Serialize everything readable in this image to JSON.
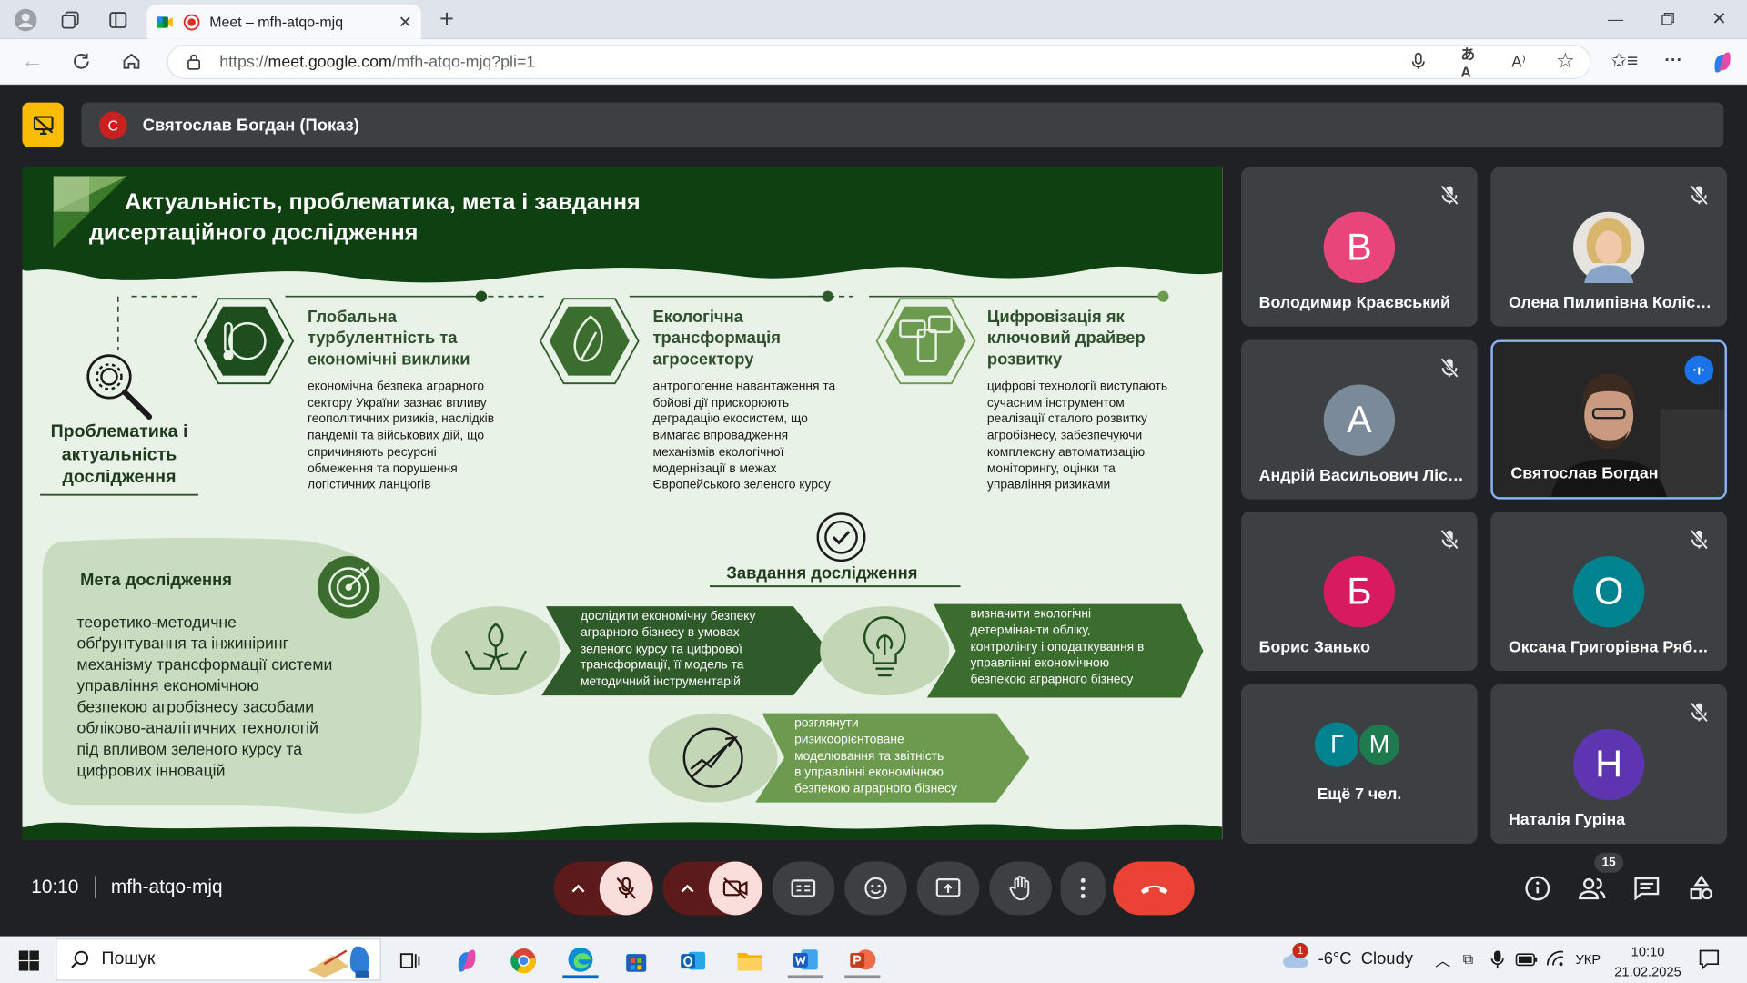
{
  "browser": {
    "tab_title": "Meet – mfh-atqo-mjq",
    "url_prefix": "https://",
    "url_host": "meet.google.com",
    "url_path": "/mfh-atqo-mjq?pli=1"
  },
  "presentation": {
    "presenter_initial": "С",
    "presenter_label": "Святослав Богдан (Показ)"
  },
  "slide": {
    "title_line1": "Актуальність, проблематика, мета і завдання",
    "title_line2": "дисертаційного дослідження",
    "problem_label_1": "Проблематика і",
    "problem_label_2": "актуальність",
    "problem_label_3": "дослідження",
    "topics": [
      {
        "title": [
          "Глобальна",
          "турбулентність та",
          "економічні виклики"
        ],
        "text": [
          "економічна безпека аграрного",
          "сектору України зазнає впливу",
          "геополітичних ризиків, наслідків",
          "пандемії та військових дій, що",
          "спричиняють ресурсні",
          "обмеження та порушення",
          "логістичних ланцюгів"
        ]
      },
      {
        "title": [
          "Екологічна",
          "трансформація",
          "агросектору"
        ],
        "text": [
          "антропогенне навантаження та",
          "бойові дії прискорюють",
          "деградацію екосистем, що",
          "вимагає впровадження",
          "механізмів екологічної",
          "модернізації в межах",
          "Європейського зеленого курсу"
        ]
      },
      {
        "title": [
          "Цифровізація як",
          "ключовий драйвер",
          "розвитку"
        ],
        "text": [
          "цифрові технології виступають",
          "сучасним інструментом",
          "реалізації сталого розвитку",
          "агробізнесу, забезпечуючи",
          "комплексну автоматизацію",
          "моніторингу, оцінки та",
          "управління ризиками"
        ]
      }
    ],
    "goal_title": "Мета дослідження",
    "goal_text": [
      "теоретико-методичне",
      "обґрунтування та інжиніринг",
      "механізму трансформації системи",
      "управління економічною",
      "безпекою агробізнесу засобами",
      "обліково-аналітичних технологій",
      "під впливом зеленого курсу та",
      "цифрових інновацій"
    ],
    "tasks_title": "Завдання дослідження",
    "tasks": [
      [
        "дослідити економічну безпеку",
        "аграрного бізнесу в умовах",
        "зеленого курсу та цифрової",
        "трансформації, її модель та",
        "методичний інструментарій"
      ],
      [
        "визначити екологічні",
        "детермінанти обліку,",
        "контролінгу і оподаткування в",
        "управлінні економічною",
        "безпекою аграрного бізнесу"
      ],
      [
        "розглянути",
        "ризикоорієнтоване",
        "моделювання та звітність",
        "в управлінні економічною",
        "безпекою аграрного бізнесу"
      ]
    ]
  },
  "participants": [
    {
      "name": "Володимир Краєвський",
      "initial": "В",
      "color": "#e8457a"
    },
    {
      "name": "Олена Пилипівна Колісник",
      "initial": "",
      "color": "#c9a67a"
    },
    {
      "name": "Андрій Васильович Лісовий",
      "initial": "А",
      "color": "#7b8a99"
    },
    {
      "name": "Святослав Богдан",
      "initial": "",
      "color": "#2a2a2a"
    },
    {
      "name": "Борис Занько",
      "initial": "Б",
      "color": "#d81b60"
    },
    {
      "name": "Оксана Григорівна Рябченко",
      "initial": "О",
      "color": "#00838f"
    },
    {
      "name": "Ещё 7 чел.",
      "initial_a": "Г",
      "initial_b": "М",
      "color_a": "#00838f",
      "color_b": "#1e7b4e"
    },
    {
      "name": "Наталія Гуріна",
      "initial": "Н",
      "color": "#5e35b1"
    }
  ],
  "meeting": {
    "time": "10:10",
    "code": "mfh-atqo-mjq",
    "people_count": "15"
  },
  "taskbar": {
    "search_placeholder": "Пошук",
    "weather_badge": "1",
    "weather": "-6°C  Cloudy",
    "lang": "УКР",
    "clock_time": "10:10",
    "clock_date": "21.02.2025"
  },
  "colors": {
    "dark_green": "#1e4d1e",
    "mid_green": "#3b6e2e",
    "light_green": "#6c9a4e",
    "pale_green": "#c8dcbf",
    "end_call": "#ea4335"
  }
}
